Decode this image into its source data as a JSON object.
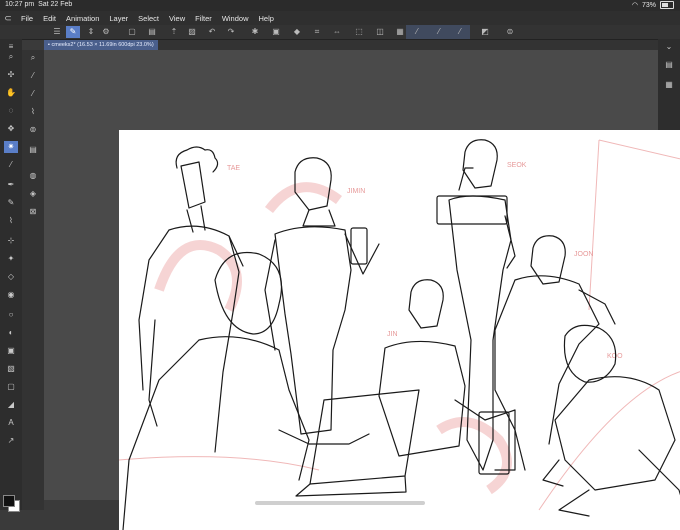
{
  "status": {
    "time": "10:27 pm",
    "date": "Sat 22 Feb",
    "battery": "73%"
  },
  "menu": [
    "File",
    "Edit",
    "Animation",
    "Layer",
    "Select",
    "View",
    "Filter",
    "Window",
    "Help"
  ],
  "tab": {
    "title": "cmeeks2* (16.53 × 11.69in 600dpi 23.0%)"
  },
  "labels": {
    "tae": "TAE",
    "jimin": "JIMIN",
    "seok": "SEOK",
    "joon": "JOON",
    "jin": "JIN",
    "koo": "KOO"
  },
  "icons": {
    "left_tools": [
      "zoom-icon",
      "move-icon",
      "hand-icon",
      "lasso-icon",
      "operation-icon",
      "eyedropper-icon",
      "pen-icon",
      "pencil-icon",
      "brush-icon",
      "airbrush-icon",
      "decorate-icon",
      "eraser-icon",
      "blend-icon",
      "fill-icon",
      "gradient-icon",
      "figure-icon",
      "frame-icon",
      "ruler-icon",
      "text-icon",
      "balloon-icon",
      "line-correction-icon"
    ],
    "right_panel": [
      "layers-icon",
      "properties-icon"
    ]
  },
  "colors": {
    "accent": "#5a7ec7",
    "main_color": "#111111",
    "sub_color": "#ffffff"
  }
}
